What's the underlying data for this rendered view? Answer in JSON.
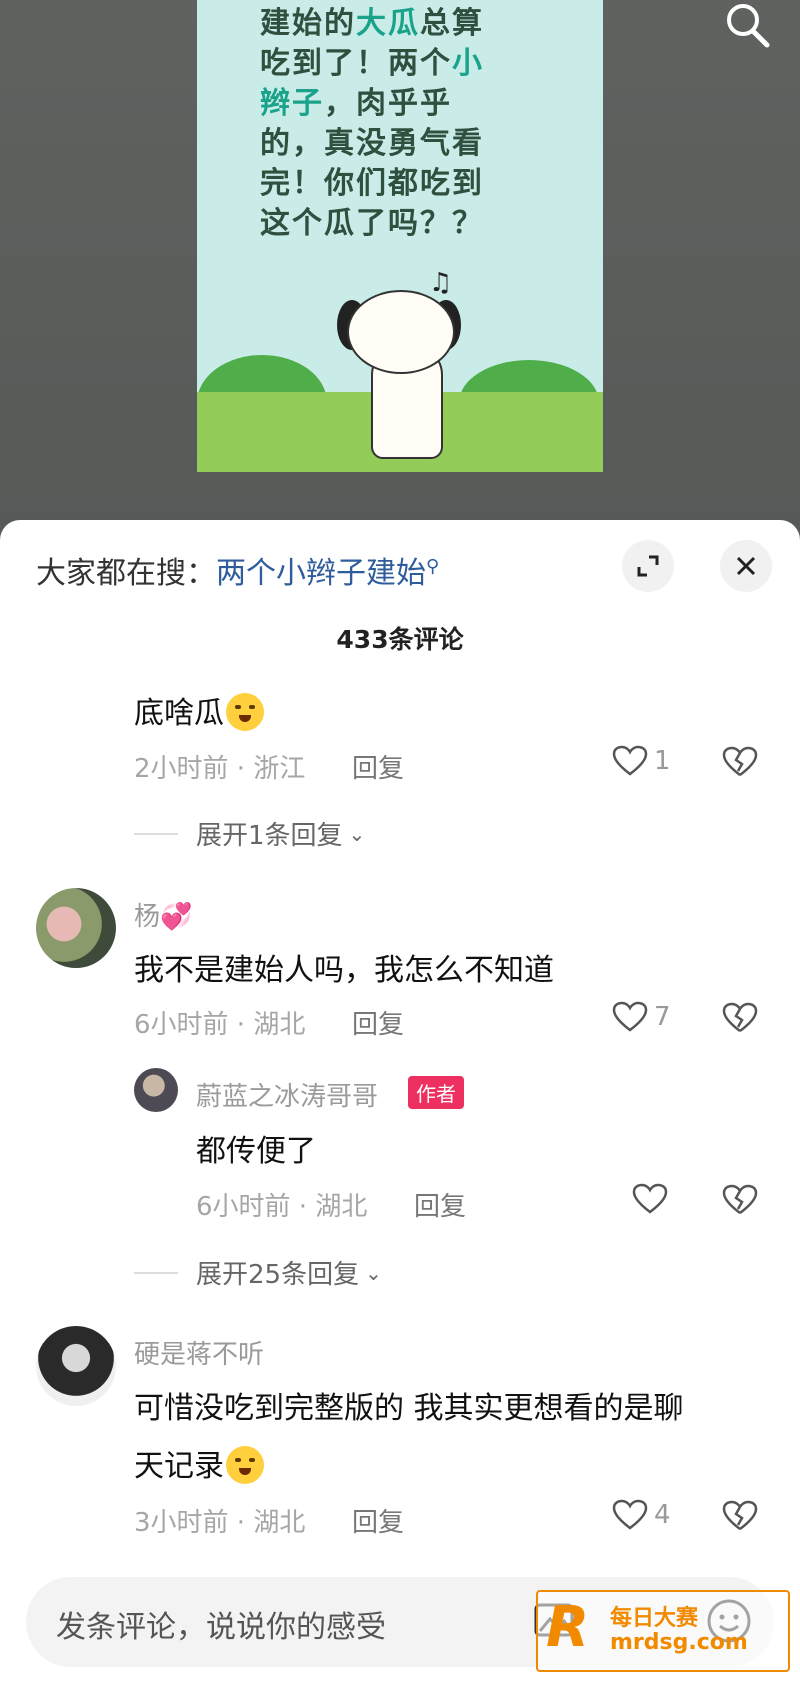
{
  "video": {
    "caption_lines": [
      {
        "parts": [
          {
            "t": "建始的",
            "hl": false
          },
          {
            "t": "大瓜",
            "hl": true
          },
          {
            "t": "总算",
            "hl": false
          }
        ]
      },
      {
        "parts": [
          {
            "t": "吃到了！两个",
            "hl": false
          },
          {
            "t": "小",
            "hl": true
          }
        ]
      },
      {
        "parts": [
          {
            "t": "辫子",
            "hl": true
          },
          {
            "t": "，肉乎乎",
            "hl": false
          }
        ]
      },
      {
        "parts": [
          {
            "t": "的，真没勇气看",
            "hl": false
          }
        ]
      },
      {
        "parts": [
          {
            "t": "完！你们都吃到",
            "hl": false
          }
        ]
      },
      {
        "parts": [
          {
            "t": "这个瓜了吗？？",
            "hl": false
          }
        ]
      }
    ],
    "note_symbol": "♫"
  },
  "sheet": {
    "trending_prefix": "大家都在搜：",
    "trending_query": "两个小辫子建始",
    "comment_count": "433条评论"
  },
  "comments": {
    "c0": {
      "text": "底啥瓜",
      "time": "2小时前 · 浙江",
      "reply": "回复",
      "likes": "1",
      "expand": "展开1条回复"
    },
    "c1": {
      "user": "杨",
      "text": "我不是建始人吗，我怎么不知道",
      "time": "6小时前 · 湖北",
      "reply": "回复",
      "likes": "7"
    },
    "c1r": {
      "user": "蔚蓝之冰涛哥哥",
      "badge": "作者",
      "text": "都传便了",
      "time": "6小时前 · 湖北",
      "reply": "回复",
      "expand": "展开25条回复"
    },
    "c2": {
      "user": "硬是蒋不听",
      "text1": "可惜没吃到完整版的 我其实更想看的是聊",
      "text2": "天记录",
      "time": "3小时前 · 湖北",
      "reply": "回复",
      "likes": "4"
    }
  },
  "input": {
    "placeholder": "发条评论，说说你的感受"
  },
  "watermark": {
    "logo": "R",
    "line1": "每日大赛",
    "line2": "mrdsg.com"
  },
  "colors": {
    "accent": "#ee3060",
    "link": "#2f5d9c",
    "watermark": "#f28a00"
  }
}
